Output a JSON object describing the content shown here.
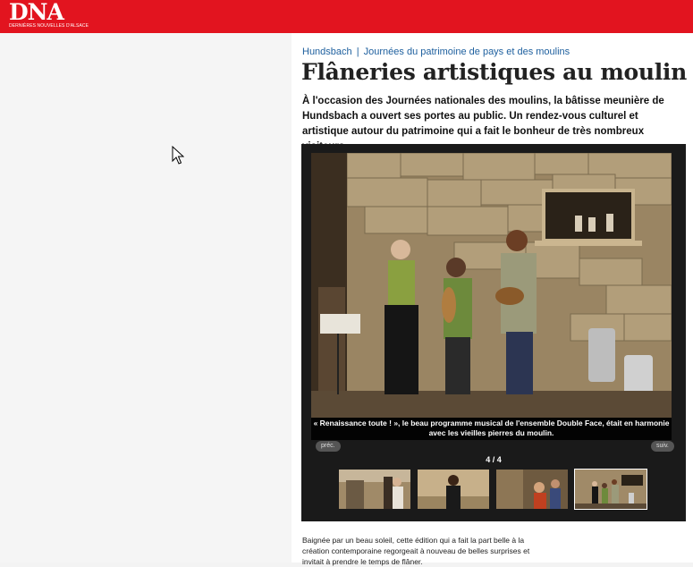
{
  "header": {
    "logo_text": "DNA",
    "logo_subtitle": "DERNIÈRES NOUVELLES D'ALSACE",
    "brand_color": "#e2141f"
  },
  "article": {
    "kicker_place": "Hundsbach",
    "kicker_separator": "|",
    "kicker_section": "Journées du patrimoine de pays et des moulins",
    "title": "Flâneries artistiques au moulin",
    "chapo": "À l'occasion des Journées nationales des moulins, la bâtisse meunière de Hundsbach a ouvert ses portes au public. Un rendez-vous culturel et artistique autour du patrimoine qui a fait le bonheur de très nombreux visiteurs.",
    "body_start": "Baignée par un beau soleil, cette édition qui a fait la part belle à la création contemporaine regorgeait à nouveau de belles surprises et invitait à prendre le temps de flâner."
  },
  "gallery": {
    "caption": "« Renaissance toute ! », le beau programme musical de l'ensemble Double Face, était en harmonie avec les vieilles pierres du moulin.",
    "prev_label": "préc.",
    "next_label": "suiv.",
    "counter": "4 / 4",
    "current_index": 4,
    "total": 4,
    "thumbnails": [
      {
        "icon": "photo-thumbnail"
      },
      {
        "icon": "photo-thumbnail"
      },
      {
        "icon": "photo-thumbnail"
      },
      {
        "icon": "photo-thumbnail",
        "active": true
      }
    ]
  },
  "cursor": {
    "icon": "mouse-pointer-icon"
  }
}
